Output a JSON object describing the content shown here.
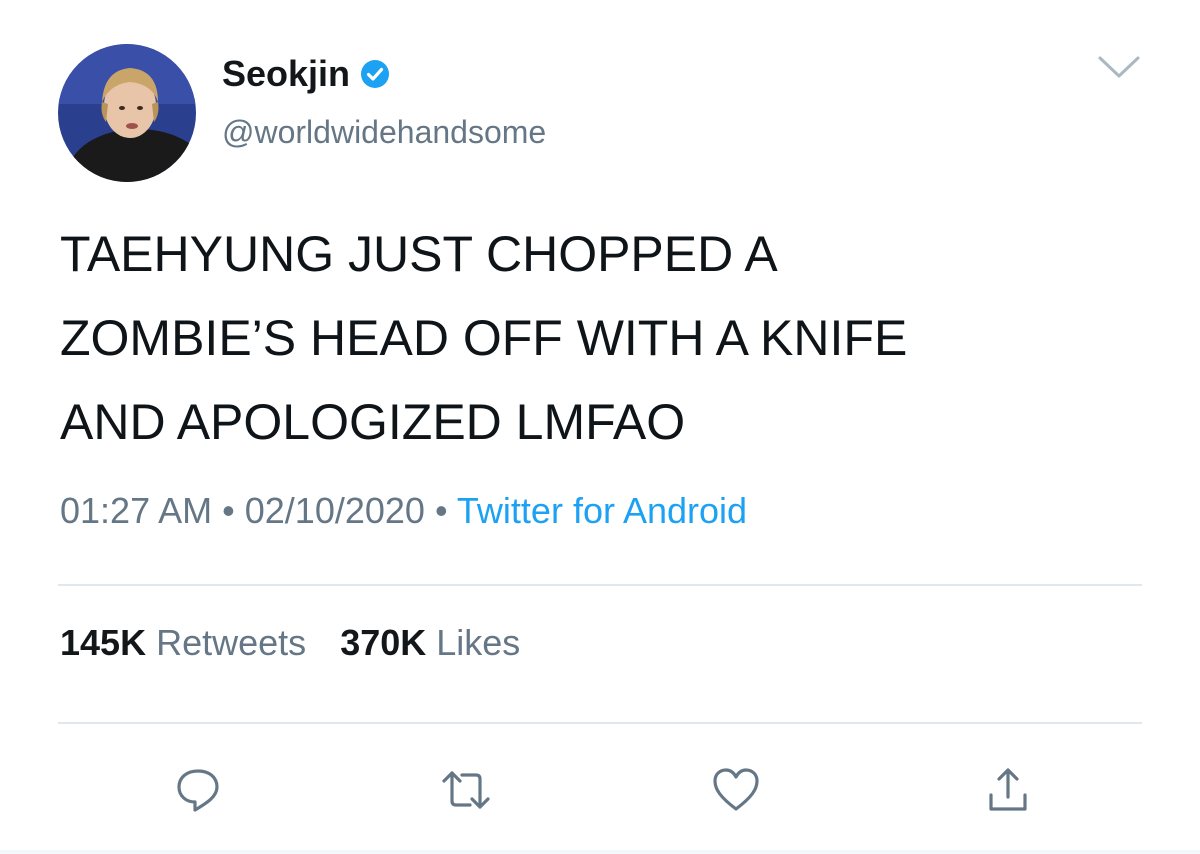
{
  "tweet": {
    "author": {
      "display_name": "Seokjin",
      "handle": "@worldwidehandsome",
      "verified": true
    },
    "text_lines": [
      "TAEHYUNG JUST CHOPPED A",
      "ZOMBIE’S HEAD OFF WITH A KNIFE",
      "AND APOLOGIZED LMFAO"
    ],
    "time": "01:27 AM",
    "date": "02/10/2020",
    "separator": "•",
    "source": "Twitter for Android",
    "stats": {
      "retweets_count": "145K",
      "retweets_label": "Retweets",
      "likes_count": "370K",
      "likes_label": "Likes"
    },
    "actions": [
      "reply-icon",
      "retweet-icon",
      "like-icon",
      "share-icon"
    ]
  },
  "colors": {
    "text": "#0f1419",
    "secondary": "#657786",
    "link": "#1da1f2",
    "divider": "#e1e8ed",
    "icon": "#657786",
    "verified": "#1da1f2"
  }
}
